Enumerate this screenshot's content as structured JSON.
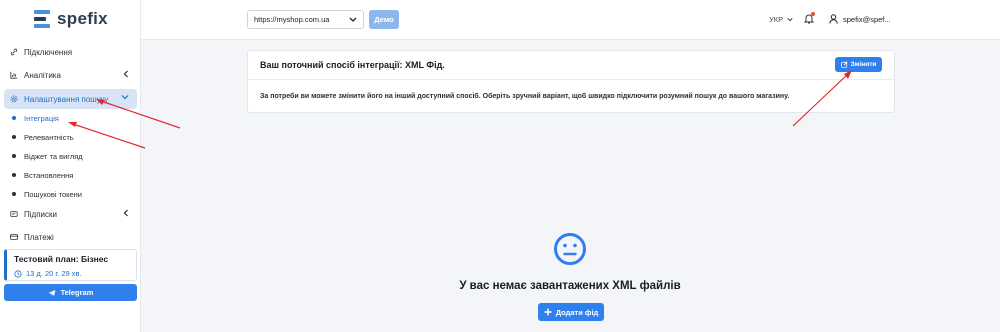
{
  "brand": {
    "name": "spefix"
  },
  "header": {
    "shop_select": "https://myshop.com.ua",
    "demo_label": "Демо",
    "language": "УКР",
    "user_email": "spefix@spef..."
  },
  "sidebar": {
    "items": [
      {
        "label": "Підключення",
        "icon": "link-icon"
      },
      {
        "label": "Аналітика",
        "icon": "chart-icon"
      },
      {
        "label": "Налаштування пошуку",
        "icon": "gear-icon"
      }
    ],
    "subitems": [
      {
        "label": "Інтеграція"
      },
      {
        "label": "Релевантність"
      },
      {
        "label": "Віджет та вигляд"
      },
      {
        "label": "Встановлення"
      },
      {
        "label": "Пошукові токени"
      }
    ],
    "items_after": [
      {
        "label": "Підписки",
        "icon": "subscription-icon"
      },
      {
        "label": "Платежі",
        "icon": "card-icon"
      }
    ],
    "plan": {
      "title": "Тестовий план: Бізнес",
      "time_left": "13 д. 20 г. 29 хв."
    },
    "telegram_label": "Telegram"
  },
  "card": {
    "title": "Ваш поточний спосіб інтеграції: XML Фід.",
    "change_label": "Змінити",
    "body": "За потреби ви можете змінити його на інший доступний спосіб. Оберіть зручний варіант, щоб швидко підключити розумний пошук до вашого магазину."
  },
  "empty_state": {
    "title": "У вас немає завантажених XML файлів",
    "add_label": "Додати фід"
  },
  "colors": {
    "accent": "#2f80ed",
    "active_bg": "#d6e4f5",
    "annotation": "#e0282e"
  }
}
